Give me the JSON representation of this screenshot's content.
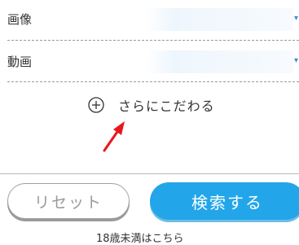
{
  "filters": {
    "image": {
      "label": "画像",
      "value": ""
    },
    "video": {
      "label": "動画",
      "value": ""
    }
  },
  "more_options": {
    "label": "さらにこだわる",
    "icon": "plus-circle-icon"
  },
  "annotation": {
    "icon": "red-arrow-icon",
    "color": "#e8161d"
  },
  "actions": {
    "reset_label": "リセット",
    "search_label": "検索する"
  },
  "footer": {
    "note": "18歳未満はこちら"
  },
  "colors": {
    "accent": "#22a6e9",
    "chevron": "#3a8ed0",
    "arrow": "#e8161d"
  }
}
